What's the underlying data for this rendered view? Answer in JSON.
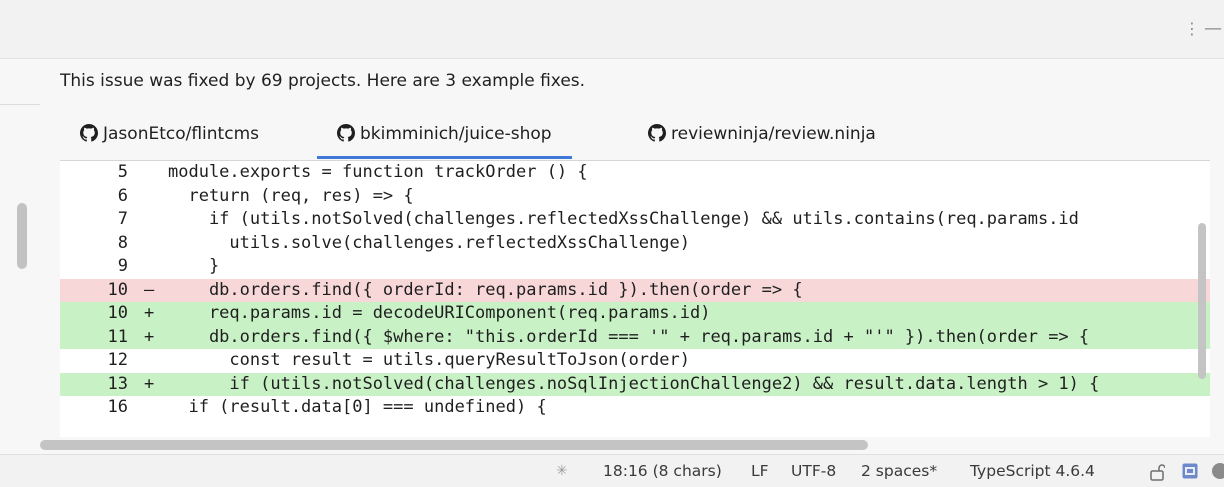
{
  "toolbar": {
    "menu_icon": "⋮",
    "minimize_icon": "—"
  },
  "summary": "This issue was fixed by 69 projects. Here are 3 example fixes.",
  "tabs": [
    {
      "label": "JasonEtco/flintcms",
      "icon": "github-icon",
      "active": false
    },
    {
      "label": "bkimminich/juice-shop",
      "icon": "github-icon",
      "active": true
    },
    {
      "label": "reviewninja/review.ninja",
      "icon": "github-icon",
      "active": false
    }
  ],
  "code": {
    "lines": [
      {
        "num": "5",
        "mark": "",
        "text": "module.exports = function trackOrder () {",
        "type": "normal"
      },
      {
        "num": "6",
        "mark": "",
        "text": "  return (req, res) => {",
        "type": "normal"
      },
      {
        "num": "7",
        "mark": "",
        "text": "    if (utils.notSolved(challenges.reflectedXssChallenge) && utils.contains(req.params.id",
        "type": "normal"
      },
      {
        "num": "8",
        "mark": "",
        "text": "      utils.solve(challenges.reflectedXssChallenge)",
        "type": "normal"
      },
      {
        "num": "9",
        "mark": "",
        "text": "    }",
        "type": "normal"
      },
      {
        "num": "10",
        "mark": "–",
        "text": "    db.orders.find({ orderId: req.params.id }).then(order => {",
        "type": "del"
      },
      {
        "num": "10",
        "mark": "+",
        "text": "    req.params.id = decodeURIComponent(req.params.id)",
        "type": "add"
      },
      {
        "num": "11",
        "mark": "+",
        "text": "    db.orders.find({ $where: \"this.orderId === '\" + req.params.id + \"'\" }).then(order => {",
        "type": "add"
      },
      {
        "num": "12",
        "mark": "",
        "text": "      const result = utils.queryResultToJson(order)",
        "type": "normal"
      },
      {
        "num": "13",
        "mark": "+",
        "text": "      if (utils.notSolved(challenges.noSqlInjectionChallenge2) && result.data.length > 1) {",
        "type": "add"
      },
      {
        "num": "16",
        "mark": "",
        "text": "  if (result.data[0] === undefined) {",
        "type": "normal"
      }
    ]
  },
  "status": {
    "position": "18:16 (8 chars)",
    "line_ending": "LF",
    "encoding": "UTF-8",
    "indent": "2 spaces*",
    "language": "TypeScript 4.6.4"
  },
  "colors": {
    "deleted_line": "#f7d7d7",
    "added_line": "#c9f1c6",
    "active_tab_underline": "#3e7ad6"
  }
}
